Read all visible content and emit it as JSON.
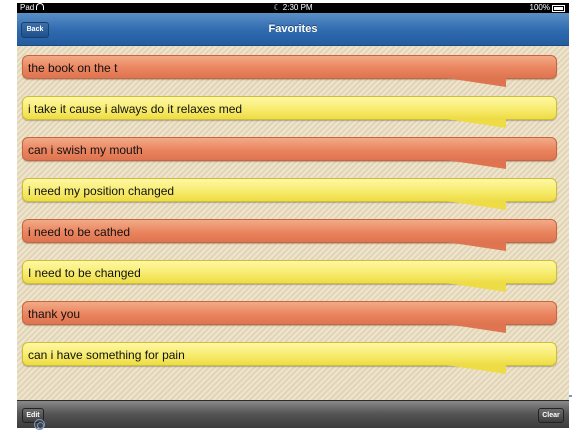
{
  "status_bar": {
    "device": "Pad",
    "time": "2:30 PM",
    "battery": "100%"
  },
  "nav": {
    "title": "Favorites",
    "back_label": "Back"
  },
  "phrases": [
    {
      "text": "the book on the t",
      "color": "orange"
    },
    {
      "text": "i take it cause i always do it relaxes med",
      "color": "yellow"
    },
    {
      "text": "can i swish my mouth",
      "color": "orange"
    },
    {
      "text": "i need my position changed",
      "color": "yellow"
    },
    {
      "text": "i need to be cathed",
      "color": "orange"
    },
    {
      "text": "I need to be changed",
      "color": "yellow"
    },
    {
      "text": "thank you",
      "color": "orange"
    },
    {
      "text": "can i have something for pain",
      "color": "yellow"
    }
  ],
  "toolbar": {
    "edit_label": "Edit",
    "clear_label": "Clear"
  },
  "colors": {
    "nav_blue": "#2f6aaf",
    "orange_bubble": "#e9825d",
    "yellow_bubble": "#f6ea6a",
    "background": "#e9dcbd"
  }
}
